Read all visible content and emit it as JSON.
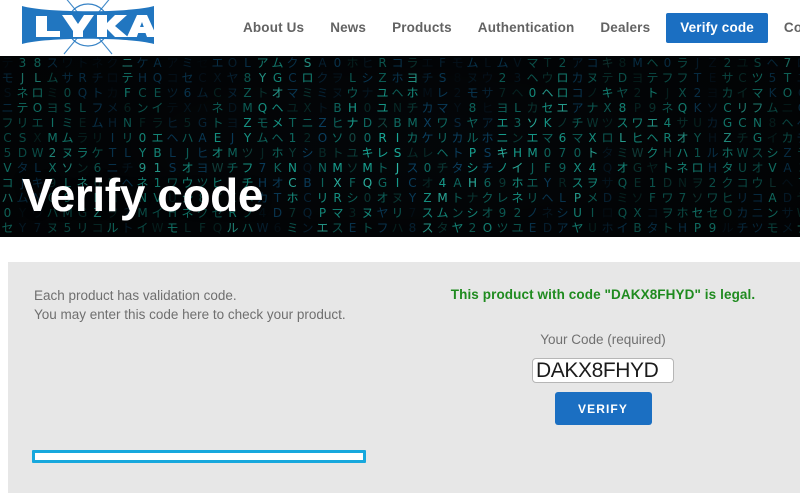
{
  "site": {
    "logo_text": "LYKA",
    "logo_color": "#2176c0"
  },
  "nav": {
    "items": [
      {
        "label": "About Us",
        "active": false
      },
      {
        "label": "News",
        "active": false
      },
      {
        "label": "Products",
        "active": false
      },
      {
        "label": "Authentication",
        "active": false
      },
      {
        "label": "Dealers",
        "active": false
      },
      {
        "label": "Verify code",
        "active": true
      },
      {
        "label": "Contact",
        "active": false
      }
    ],
    "active_bg": "#1b6fc2",
    "inactive_color": "#636363"
  },
  "hero": {
    "title": "Verify code",
    "background_style": "matrix-code-rain",
    "background_base_color": "#04070a",
    "glyph_colors": [
      "#1fd6c0",
      "#15a89a",
      "#1070a8",
      "#0d4f7a",
      "#0a3252",
      "#38e8d2"
    ],
    "glyphs": "ABCDEFGHIJKLMNOPQRSTUVWXYZ0123456789アイウエオカキクケコサシスセソタチツテトナニヌネノハヒフヘホマミムメモヤユヨラリルレロワヲン"
  },
  "main": {
    "background": "#e7e7e7",
    "intro_line1": "Each product has validation code.",
    "intro_line2": "You may enter this code here to check your product.",
    "intro_color": "#6f6f6f",
    "result_message": "This product with code \"DAKX8FHYD\" is legal.",
    "result_color": "#1f8b1f",
    "field_label": "Your Code (required)",
    "code_value": "DAKX8FHYD",
    "code_placeholder": "",
    "verify_button": "VERIFY",
    "progress_percent": 0,
    "progress_color": "#17a8dd"
  }
}
